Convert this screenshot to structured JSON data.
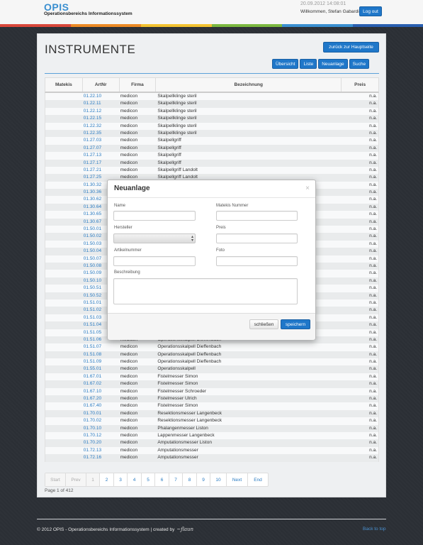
{
  "header": {
    "brand": "OPIS",
    "brand_subtitle": "Operationsbereichs Informationssystem",
    "datetime": "20.09.2012 14:08:01",
    "welcome": "Willkommen, Stefan Gabardi",
    "logout_label": "Log out",
    "stripe_colors": [
      "#d9483b",
      "#ec8a25",
      "#f2c230",
      "#7bb83f",
      "#3a8fd0",
      "#2a5fb0"
    ]
  },
  "page": {
    "title": "INSTRUMENTE",
    "back_label": "zurück zur Hauptseite",
    "toolbar": [
      "Übersicht",
      "Liste",
      "Neuanlage",
      "Suche"
    ]
  },
  "table": {
    "columns": [
      "Matekis",
      "ArtNr",
      "Firma",
      "Bezeichnung",
      "Preis"
    ],
    "rows": [
      [
        "",
        "01.22.10",
        "medicon",
        "Skalpellklinge steril",
        "n.a."
      ],
      [
        "",
        "01.22.11",
        "medicon",
        "Skalpellklinge steril",
        "n.a."
      ],
      [
        "",
        "01.22.12",
        "medicon",
        "Skalpellklinge steril",
        "n.a."
      ],
      [
        "",
        "01.22.15",
        "medicon",
        "Skalpellklinge steril",
        "n.a."
      ],
      [
        "",
        "01.22.32",
        "medicon",
        "Skalpellklinge steril",
        "n.a."
      ],
      [
        "",
        "01.22.35",
        "medicon",
        "Skalpellklinge steril",
        "n.a."
      ],
      [
        "",
        "01.27.03",
        "medicon",
        "Skalpellgriff",
        "n.a."
      ],
      [
        "",
        "01.27.07",
        "medicon",
        "Skalpellgriff",
        "n.a."
      ],
      [
        "",
        "01.27.13",
        "medicon",
        "Skalpellgriff",
        "n.a."
      ],
      [
        "",
        "01.27.17",
        "medicon",
        "Skalpellgriff",
        "n.a."
      ],
      [
        "",
        "01.27.21",
        "medicon",
        "Skalpellgriff Landolt",
        "n.a."
      ],
      [
        "",
        "01.27.25",
        "medicon",
        "Skalpellgriff Landolt",
        "n.a."
      ],
      [
        "",
        "01.30.32",
        "",
        "",
        "n.a."
      ],
      [
        "",
        "01.30.36",
        "",
        "",
        "n.a."
      ],
      [
        "",
        "01.30.62",
        "",
        "",
        "n.a."
      ],
      [
        "",
        "01.30.64",
        "",
        "",
        "n.a."
      ],
      [
        "",
        "01.30.65",
        "",
        "",
        "n.a."
      ],
      [
        "",
        "01.30.67",
        "",
        "",
        "n.a."
      ],
      [
        "",
        "01.50.01",
        "",
        "",
        "n.a."
      ],
      [
        "",
        "01.50.02",
        "",
        "",
        "n.a."
      ],
      [
        "",
        "01.50.03",
        "",
        "",
        "n.a."
      ],
      [
        "",
        "01.50.04",
        "",
        "",
        "n.a."
      ],
      [
        "",
        "01.50.07",
        "",
        "",
        "n.a."
      ],
      [
        "",
        "01.50.08",
        "",
        "",
        "n.a."
      ],
      [
        "",
        "01.50.09",
        "",
        "",
        "n.a."
      ],
      [
        "",
        "01.50.10",
        "",
        "",
        "n.a."
      ],
      [
        "",
        "01.50.51",
        "",
        "",
        "n.a."
      ],
      [
        "",
        "01.50.52",
        "",
        "",
        "n.a."
      ],
      [
        "",
        "01.51.01",
        "",
        "",
        "n.a."
      ],
      [
        "",
        "01.51.02",
        "",
        "",
        "n.a."
      ],
      [
        "",
        "01.51.03",
        "",
        "",
        "n.a."
      ],
      [
        "",
        "01.51.04",
        "",
        "",
        "n.a."
      ],
      [
        "",
        "01.51.05",
        "",
        "",
        "n.a."
      ],
      [
        "",
        "01.51.06",
        "medicon",
        "Operationsskalpell Dieffenbach",
        "n.a."
      ],
      [
        "",
        "01.51.07",
        "medicon",
        "Operationsskalpell Dieffenbach",
        "n.a."
      ],
      [
        "",
        "01.51.08",
        "medicon",
        "Operationsskalpell Dieffenbach",
        "n.a."
      ],
      [
        "",
        "01.51.09",
        "medicon",
        "Operationsskalpell Dieffenbach",
        "n.a."
      ],
      [
        "",
        "01.55.01",
        "medicon",
        "Operationsskalpell",
        "n.a."
      ],
      [
        "",
        "01.67.01",
        "medicon",
        "Fistelmesser Simon",
        "n.a."
      ],
      [
        "",
        "01.67.02",
        "medicon",
        "Fistelmesser Simon",
        "n.a."
      ],
      [
        "",
        "01.67.10",
        "medicon",
        "Fistelmesser Schroeder",
        "n.a."
      ],
      [
        "",
        "01.67.20",
        "medicon",
        "Fistelmesser Ulrich",
        "n.a."
      ],
      [
        "",
        "01.67.40",
        "medicon",
        "Fistelmesser Simon",
        "n.a."
      ],
      [
        "",
        "01.70.01",
        "medicon",
        "Resektionsmesser Langenbeck",
        "n.a."
      ],
      [
        "",
        "01.70.02",
        "medicon",
        "Resektionsmesser Langenbeck",
        "n.a."
      ],
      [
        "",
        "01.70.10",
        "medicon",
        "Phalangenmesser Liston",
        "n.a."
      ],
      [
        "",
        "01.70.12",
        "medicon",
        "Lappenmesser Langenbeck",
        "n.a."
      ],
      [
        "",
        "01.70.20",
        "medicon",
        "Amputationsmesser Liston",
        "n.a."
      ],
      [
        "",
        "01.72.13",
        "medicon",
        "Amputationsmesser",
        "n.a."
      ],
      [
        "",
        "01.72.16",
        "medicon",
        "Amputationsmesser",
        "n.a."
      ]
    ]
  },
  "pagination": {
    "items": [
      "Start",
      "Prev",
      "1",
      "2",
      "3",
      "4",
      "5",
      "6",
      "7",
      "8",
      "9",
      "10",
      "Next",
      "End"
    ],
    "info": "Page 1 of 412"
  },
  "modal": {
    "title": "Neuanlage",
    "close_symbol": "×",
    "labels": {
      "name": "Name",
      "matekis": "Matekis Nummer",
      "hersteller": "Hersteller",
      "preis": "Preis",
      "artikelnummer": "Artikelnummer",
      "foto": "Foto",
      "beschreibung": "Beschreibung"
    },
    "close_label": "schließen",
    "save_label": "speichern"
  },
  "footer": {
    "text": "© 2012 OPIS - Operationsbereichs Informationssystem | created by",
    "back_to_top": "Back to top"
  }
}
